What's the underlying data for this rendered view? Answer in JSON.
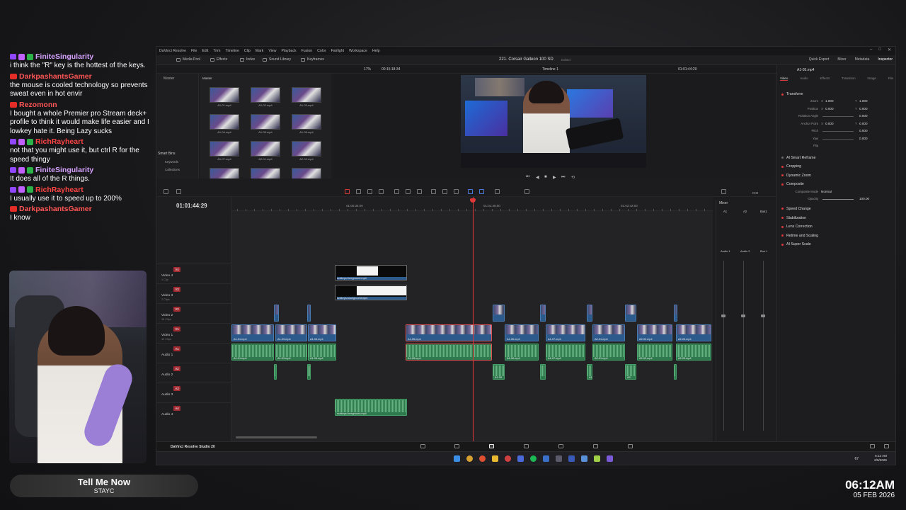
{
  "chat": {
    "messages": [
      {
        "platform": "twitch",
        "user": "FiniteSingularity",
        "user_color": "#d5a3ff",
        "text": "i think the \"R\" key is the hottest of the keys."
      },
      {
        "platform": "youtube",
        "user": "DarkpashantsGamer",
        "user_color": "#ff5555",
        "text": "the mouse is cooled technology so prevents sweat even in hot envir"
      },
      {
        "platform": "youtube",
        "user": "Rezomonn",
        "user_color": "#ff5555",
        "text": "I bought a whole Premier pro Stream deck+ profile to think it would make life easier and I lowkey hate it. Being Lazy sucks"
      },
      {
        "platform": "twitch",
        "user": "RichRayheart",
        "user_color": "#ff4444",
        "text": "not that you might use it, but ctrl R for the speed thingy"
      },
      {
        "platform": "twitch",
        "user": "FiniteSingularity",
        "user_color": "#d5a3ff",
        "text": "It does all of the R things."
      },
      {
        "platform": "twitch",
        "user": "RichRayheart",
        "user_color": "#ff4444",
        "text": "I usually use it to speed up to 200%"
      },
      {
        "platform": "youtube",
        "user": "DarkpashantsGamer",
        "user_color": "#ff5555",
        "text": "I know"
      }
    ]
  },
  "now_playing": {
    "title": "Tell Me Now",
    "artist": "STAYC"
  },
  "clock": {
    "time": "06:12AM",
    "date": "05 FEB 2026"
  },
  "resolve": {
    "menu": [
      "DaVinci Resolve",
      "File",
      "Edit",
      "Trim",
      "Timeline",
      "Clip",
      "Mark",
      "View",
      "Playback",
      "Fusion",
      "Color",
      "Fairlight",
      "Workspace",
      "Help"
    ],
    "toolbar_left": [
      "Media Pool",
      "Effects",
      "Index",
      "Sound Library",
      "Keyframes"
    ],
    "project_name": "221. Corsair Galleon 100 SD",
    "project_status": "Edited",
    "toolbar_right": [
      "Quick Export",
      "Mixer",
      "Metadata",
      "Inspector"
    ],
    "zoom": "17%",
    "source_tc": "00:15:18:34",
    "timeline_name": "Timeline 1",
    "record_tc": "01:01:44:29",
    "pool": {
      "bin_master": "Master",
      "smart_bins": "Smart Bins",
      "keywords": "Keywords",
      "collections": "Collections",
      "master_tab": "Master",
      "clips": [
        "A1-01.mp4",
        "A1-02.mp4",
        "A1-03.mp4",
        "A1-04.mp4",
        "A1-05.mp4",
        "A1-06.mp4",
        "A1-07.mp4",
        "A2-01.mp4",
        "A2-02.mp4",
        "A2-03.mp4",
        "A2-04.mp4",
        "A2-05.mp4"
      ]
    },
    "inspector": {
      "file": "A1-05.mp4",
      "tabs": [
        "Video",
        "Audio",
        "Effects",
        "Transition",
        "Image",
        "File"
      ],
      "transform": "Transform",
      "fields": [
        {
          "label": "Zoom",
          "x": "1.000",
          "y": "1.000"
        },
        {
          "label": "Position",
          "x": "0.000",
          "y": "0.000"
        },
        {
          "label": "Rotation Angle",
          "v": "0.000"
        },
        {
          "label": "Anchor Point",
          "x": "0.000",
          "y": "0.000"
        },
        {
          "label": "Pitch",
          "v": "0.000"
        },
        {
          "label": "Yaw",
          "v": "0.000"
        },
        {
          "label": "Flip",
          "v": ""
        }
      ],
      "sections": [
        "AI Smart Reframe",
        "Cropping",
        "Dynamic Zoom",
        "Composite",
        "Speed Change",
        "Stabilization",
        "Lens Correction",
        "Retime and Scaling",
        "AI Super Scale"
      ],
      "composite_mode_label": "Composite Mode",
      "composite_mode": "Normal",
      "opacity_label": "Opacity",
      "opacity": "100.00"
    },
    "timeline": {
      "timecode": "01:01:44:29",
      "ruler": [
        "01:00:34:00",
        "01:01:48:00",
        "01:02:42:00"
      ],
      "tracks": [
        {
          "name": "Video 4",
          "clips": "1 Clip",
          "tag": "V4"
        },
        {
          "name": "Video 3",
          "clips": "2 Clips",
          "tag": "V3"
        },
        {
          "name": "Video 2",
          "clips": "36 Clips",
          "tag": "V2"
        },
        {
          "name": "Video 1",
          "clips": "43 Clips",
          "tag": "V1"
        },
        {
          "name": "Audio 1",
          "clips": "",
          "tag": "A1"
        },
        {
          "name": "Audio 2",
          "clips": "",
          "tag": "A2"
        },
        {
          "name": "Audio 3",
          "clips": "",
          "tag": "A3"
        },
        {
          "name": "Audio 4",
          "clips": "",
          "tag": "A4"
        }
      ],
      "mask_clips": [
        "scdkeys-foreground.mp4",
        "scdkeys-background.mp4"
      ],
      "audio4_clip": "scdkeys-foreground.mp4",
      "v1_clips": [
        "A1-01.mp4",
        "A1-03.mp4",
        "A1-04.mp4",
        "A1-05.mp4",
        "A1-06.mp4",
        "A1-07.mp4",
        "A2-01.mp4",
        "A2-02.mp4",
        "A2-03.mp4"
      ],
      "a1_clips": [
        "A1-01.mp4",
        "A1-03.mp4",
        "A1-04.mp4",
        "A1-05.mp4",
        "A1-06.mp4",
        "A1-07.mp4",
        "A2-01.mp4",
        "A2-02.mp4",
        "A2-03.mp4"
      ],
      "a2_clips": [
        "A1-05",
        "A1-",
        "A2-"
      ]
    },
    "mixer": {
      "title": "Mixer",
      "channels": [
        "A1",
        "A2",
        "Bus1"
      ],
      "strips": [
        "Audio 1",
        "Audio 2",
        "Bus 1"
      ],
      "dim": "DIM"
    },
    "app_name": "DaVinci Resolve Studio 20",
    "tray_time": "6:12 AM",
    "tray_date": "2/5/2026",
    "tray_volume": "67"
  },
  "colors": {
    "accent": "#d43a3a",
    "video_clip": "#2c5a8c",
    "audio_clip": "#2e7a4e",
    "playhead": "#e03838"
  }
}
